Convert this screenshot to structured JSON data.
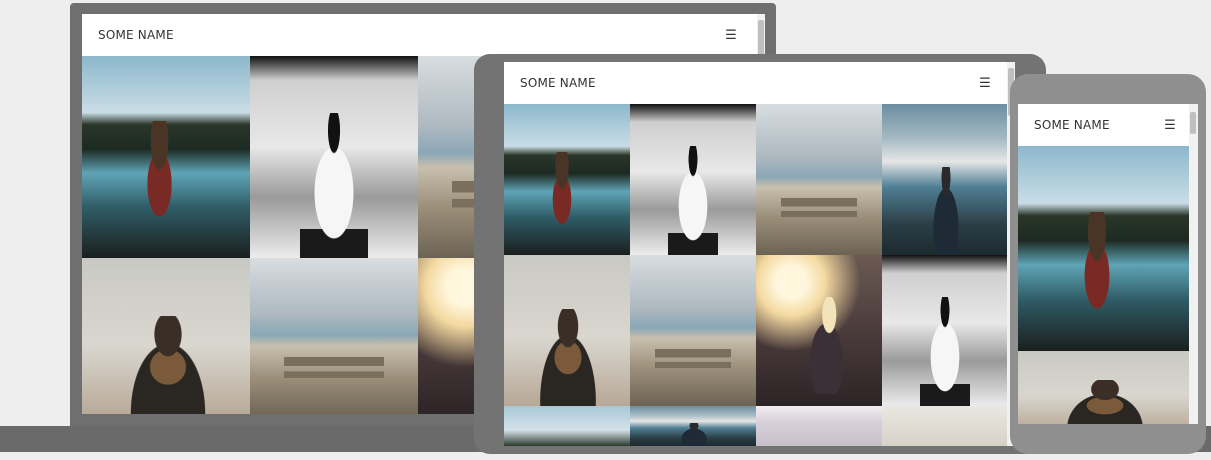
{
  "brand": "SOME NAME",
  "menu_icon": "☰",
  "icons": {
    "menu": "hamburger-menu-icon"
  },
  "colors": {
    "background": "#eeeeee",
    "device_dark": "#6f6f6f",
    "device_tablet": "#737373",
    "device_phone": "#8f8f8f",
    "navbar_bg": "#ffffff",
    "text": "#333333"
  },
  "devices": {
    "laptop": {
      "brand": "SOME NAME",
      "photos": [
        "girl in canoe on lake",
        "girl at train platform",
        "person on bench",
        "man with scarf",
        "person on bench",
        "girl in sunlight"
      ]
    },
    "tablet": {
      "brand": "SOME NAME",
      "photos": [
        "girl in canoe on lake",
        "girl at train platform",
        "person on bench",
        "man at mountain lake",
        "man with scarf",
        "person on bench",
        "girl in sunlight",
        "girl at train platform",
        "lake",
        "mountain lake",
        "rocks",
        "field"
      ]
    },
    "phone": {
      "brand": "SOME NAME",
      "photos": [
        "girl in canoe on lake",
        "man with scarf"
      ]
    }
  }
}
